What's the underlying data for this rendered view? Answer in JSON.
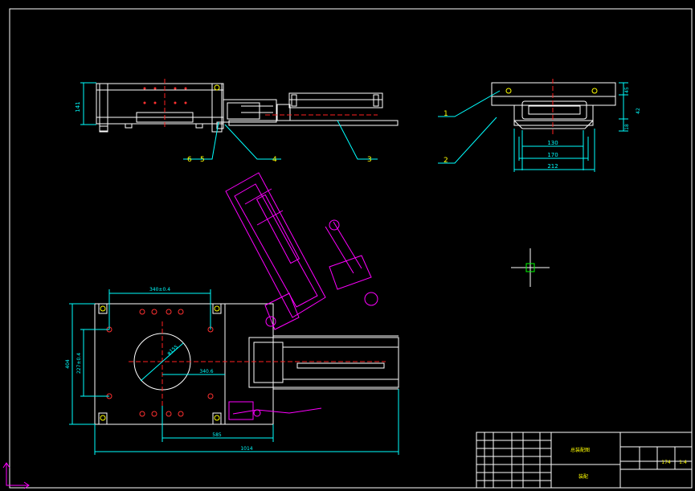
{
  "drawing": {
    "colors": {
      "background": "#000000",
      "outline": "#ffffff",
      "dimension": "#00ffff",
      "leader": "#00ffff",
      "label": "#ffff00",
      "center_line": "#ff2020",
      "hidden_part": "#ff00ff",
      "hole": "#ff3030",
      "cursor": "#00ff00"
    },
    "part_labels": [
      "1",
      "2",
      "3",
      "4",
      "5",
      "6"
    ],
    "dimensions": {
      "side_height": "141",
      "end_18": "18",
      "end_42": "42",
      "end_45": "45",
      "end_130": "130",
      "end_170": "170",
      "end_212": "212",
      "plan_340": "340±0.4",
      "plan_dia": "φ155",
      "plan_340b": "340.6",
      "plan_404": "404",
      "plan_227": "227±0.4",
      "plan_585": "585",
      "plan_1014": "1014"
    },
    "title_block": {
      "drawing_name": "总装配图",
      "scale": "1:4",
      "sheet": "174",
      "code": "装配"
    }
  }
}
